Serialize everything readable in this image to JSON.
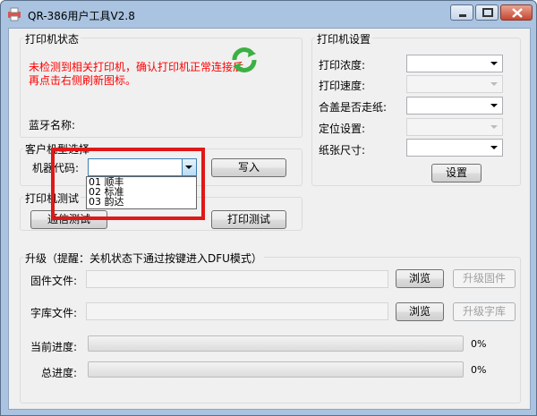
{
  "window": {
    "title": "QR-386用户工具V2.8",
    "icon": "printer-app-icon",
    "controls": {
      "minimize": "minimize-icon",
      "maximize": "maximize-icon",
      "close": "close-icon"
    }
  },
  "printer_status": {
    "title": "打印机状态",
    "warning": "未检测到相关打印机，确认打印机正常连接后再点击右侧刷新图标。",
    "refresh_icon": "refresh-icon",
    "bluetooth_label": "蓝牙名称:",
    "bluetooth_name": ""
  },
  "customer_model": {
    "title": "客户机型选择",
    "code_label": "机器代码:",
    "code_value": "",
    "options": [
      "01 顺丰",
      "02 标准",
      "03 韵达"
    ],
    "write_button": "写入"
  },
  "print_test": {
    "title": "打印机测试",
    "comm_test_button": "通信测试",
    "print_test_button": "打印测试"
  },
  "printer_settings": {
    "title": "打印机设置",
    "fields": [
      {
        "label": "打印浓度:",
        "value": "",
        "enabled": true
      },
      {
        "label": "打印速度:",
        "value": "",
        "enabled": false
      },
      {
        "label": "合盖是否走纸:",
        "value": "",
        "enabled": true
      },
      {
        "label": "定位设置:",
        "value": "",
        "enabled": false
      },
      {
        "label": "纸张尺寸:",
        "value": "",
        "enabled": true
      }
    ],
    "set_button": "设置"
  },
  "upgrade": {
    "title": "升级（提醒：关机状态下通过按键进入DFU模式）",
    "firmware_label": "固件文件:",
    "firmware_path": "",
    "font_label": "字库文件:",
    "font_path": "",
    "browse_button": "浏览",
    "upgrade_firmware_button": "升级固件",
    "upgrade_font_button": "升级字库",
    "current_progress_label": "当前进度:",
    "current_progress_value": "0%",
    "current_progress": 0,
    "total_progress_label": "总进度:",
    "total_progress_value": "0%",
    "total_progress": 0
  },
  "colors": {
    "warning": "#ff0000",
    "highlight": "#e01818",
    "refresh": "#3cb043",
    "progress": "#06b025"
  }
}
